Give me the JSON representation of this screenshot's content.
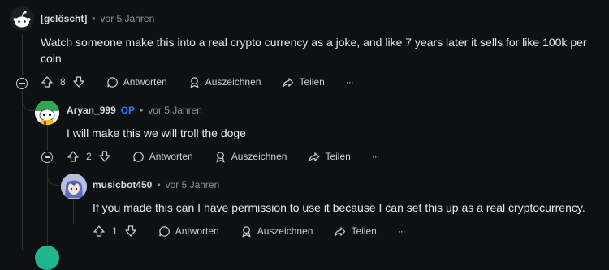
{
  "comments": [
    {
      "author": "[gelöscht]",
      "dot": "•",
      "time": "vor 5 Jahren",
      "body": "Watch someone make this into a real crypto currency as a joke, and like 7 years later it sells for like 100k per coin",
      "score": "8"
    },
    {
      "author": "Aryan_999",
      "op_badge": "OP",
      "dot": "•",
      "time": "vor 5 Jahren",
      "body": "I will make this we will troll the doge",
      "score": "2"
    },
    {
      "author": "musicbot450",
      "dot": "•",
      "time": "vor 5 Jahren",
      "body": "If you made this can I have permission to use it because I can set this up as a real cryptocurrency.",
      "score": "1"
    }
  ],
  "actions": {
    "reply": "Antworten",
    "award": "Auszeichnen",
    "share": "Teilen",
    "more": "···"
  },
  "colors": {
    "background": "#0e1113",
    "text": "#d7dadc",
    "muted": "#8a959c",
    "op_blue": "#2b7cff"
  }
}
